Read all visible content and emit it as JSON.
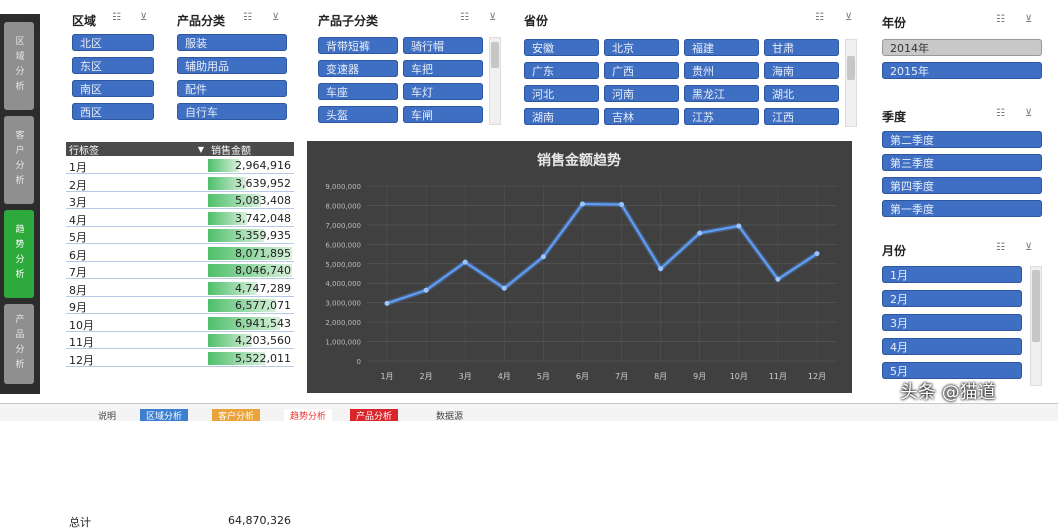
{
  "side_tabs": [
    "区域分析",
    "客户分析",
    "趋势分析",
    "产品分析"
  ],
  "slicers": {
    "region": {
      "title": "区域",
      "items": [
        "北区",
        "东区",
        "南区",
        "西区"
      ]
    },
    "category": {
      "title": "产品分类",
      "items": [
        "服装",
        "辅助用品",
        "配件",
        "自行车"
      ]
    },
    "subcategory": {
      "title": "产品子分类",
      "items": [
        "背带短裤",
        "骑行帽",
        "变速器",
        "车把",
        "车座",
        "车灯",
        "头盔",
        "车闸"
      ]
    },
    "province": {
      "title": "省份",
      "items": [
        "安徽",
        "北京",
        "福建",
        "甘肃",
        "广东",
        "广西",
        "贵州",
        "海南",
        "河北",
        "河南",
        "黑龙江",
        "湖北",
        "湖南",
        "吉林",
        "江苏",
        "江西"
      ]
    },
    "year": {
      "title": "年份",
      "items": [
        "2014年",
        "2015年"
      ]
    },
    "quarter": {
      "title": "季度",
      "items": [
        "第二季度",
        "第三季度",
        "第四季度",
        "第一季度"
      ]
    },
    "month": {
      "title": "月份",
      "items": [
        "1月",
        "2月",
        "3月",
        "4月",
        "5月"
      ]
    }
  },
  "slicer_icons": {
    "multi_select": "multi-select-icon",
    "clear_filter": "clear-filter-icon"
  },
  "table": {
    "headers": [
      "行标签",
      "销售金额"
    ],
    "rows": [
      {
        "month": "1月",
        "value": "2,964,916",
        "n": 2964916
      },
      {
        "month": "2月",
        "value": "3,639,952",
        "n": 3639952
      },
      {
        "month": "3月",
        "value": "5,083,408",
        "n": 5083408
      },
      {
        "month": "4月",
        "value": "3,742,048",
        "n": 3742048
      },
      {
        "month": "5月",
        "value": "5,359,935",
        "n": 5359935
      },
      {
        "month": "6月",
        "value": "8,071,895",
        "n": 8071895
      },
      {
        "month": "7月",
        "value": "8,046,740",
        "n": 8046740
      },
      {
        "month": "8月",
        "value": "4,747,289",
        "n": 4747289
      },
      {
        "month": "9月",
        "value": "6,577,071",
        "n": 6577071
      },
      {
        "month": "10月",
        "value": "6,941,543",
        "n": 6941543
      },
      {
        "month": "11月",
        "value": "4,203,560",
        "n": 4203560
      },
      {
        "month": "12月",
        "value": "5,522,011",
        "n": 5522011
      }
    ],
    "total_label": "总计",
    "total_value": "64,870,326"
  },
  "chart_data": {
    "type": "line",
    "title": "销售金额趋势",
    "categories": [
      "1月",
      "2月",
      "3月",
      "4月",
      "5月",
      "6月",
      "7月",
      "8月",
      "9月",
      "10月",
      "11月",
      "12月"
    ],
    "values": [
      2964916,
      3639952,
      5083408,
      3742048,
      5359935,
      8071895,
      8046740,
      4747289,
      6577071,
      6941543,
      4203560,
      5522011
    ],
    "ylim": [
      0,
      9000000
    ],
    "yticks": [
      "0",
      "1,000,000",
      "2,000,000",
      "3,000,000",
      "4,000,000",
      "5,000,000",
      "6,000,000",
      "7,000,000",
      "8,000,000",
      "9,000,000"
    ],
    "grid": true,
    "colors": {
      "background": "#404040",
      "line": "#5fa0ff",
      "grid": "#5a5a5a"
    }
  },
  "sheet_tabs": [
    "说明",
    "区域分析",
    "客户分析",
    "趋势分析",
    "产品分析",
    "数据源"
  ],
  "watermark": "头条 @猫道"
}
